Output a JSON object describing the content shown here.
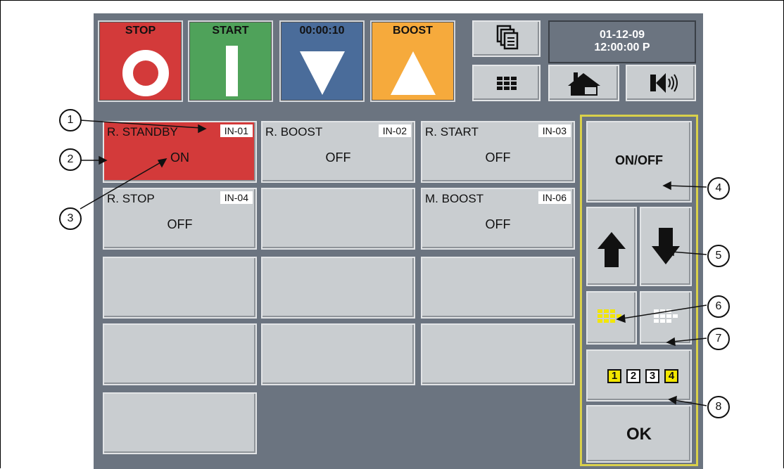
{
  "top_buttons": {
    "stop_label": "STOP",
    "start_label": "START",
    "timer_label": "00:00:10",
    "boost_label": "BOOST"
  },
  "datetime": {
    "date": "01-12-09",
    "time": "12:00:00 P"
  },
  "inputs": [
    {
      "name": "R. STANDBY",
      "code": "IN-01",
      "state": "ON"
    },
    {
      "name": "R. BOOST",
      "code": "IN-02",
      "state": "OFF"
    },
    {
      "name": "R. START",
      "code": "IN-03",
      "state": "OFF"
    },
    {
      "name": "R. STOP",
      "code": "IN-04",
      "state": "OFF"
    },
    {
      "name": "M. BOOST",
      "code": "IN-06",
      "state": "OFF"
    }
  ],
  "side_panel": {
    "onoff_label": "ON/OFF",
    "pages": [
      "1",
      "2",
      "3",
      "4"
    ],
    "ok_label": "OK"
  },
  "callouts": [
    "1",
    "2",
    "3",
    "4",
    "5",
    "6",
    "7",
    "8"
  ],
  "colors": {
    "stop": "#d33a3a",
    "start": "#4fa25a",
    "timer": "#4a6c9a",
    "boost": "#f6aa3c",
    "panel_border": "#d9d04a",
    "highlight": "#f2e600"
  },
  "icons": [
    "copy-icon",
    "grid-icon",
    "house-icon",
    "speaker-icon",
    "arrow-up-icon",
    "arrow-down-icon",
    "keypad-yellow-icon",
    "keypad-white-icon"
  ]
}
